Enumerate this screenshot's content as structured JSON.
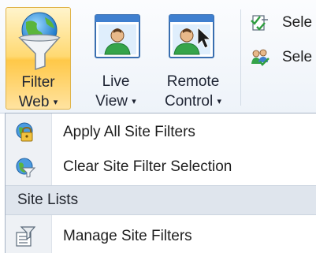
{
  "ribbon": {
    "filter_web": {
      "line1": "Filter",
      "line2": "Web",
      "icon": "globe-funnel-icon"
    },
    "live_view": {
      "line1": "Live",
      "line2": "View",
      "icon": "user-window-icon"
    },
    "remote_control": {
      "line1": "Remote",
      "line2": "Control",
      "icon": "user-window-cursor-icon"
    },
    "small_buttons": [
      {
        "label": "Sele",
        "icon": "checklist-icon"
      },
      {
        "label": "Sele",
        "icon": "users-check-icon"
      }
    ],
    "dropdown_caret": "▾"
  },
  "menu": {
    "items": [
      {
        "label": "Apply All Site Filters",
        "icon": "globe-lock-icon"
      },
      {
        "label": "Clear Site Filter Selection",
        "icon": "globe-clear-icon"
      },
      {
        "label": "Manage Site Filters",
        "icon": "manage-filter-icon"
      }
    ],
    "section_header": "Site Lists"
  },
  "colors": {
    "accent": "#ffc848",
    "menu_section": "#dfe5ed"
  }
}
